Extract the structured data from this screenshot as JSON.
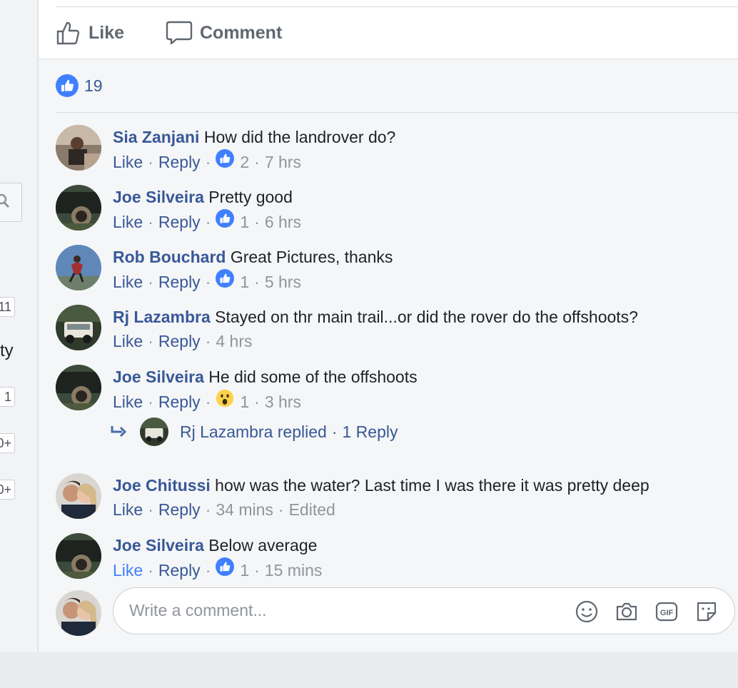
{
  "sidebar": {
    "badges": [
      "11",
      "1",
      "0+",
      "0+"
    ],
    "fragment_text": "ty"
  },
  "actions": {
    "like_label": "Like",
    "comment_label": "Comment"
  },
  "reactions": {
    "count": "19"
  },
  "comments": [
    {
      "author": "Sia Zanjani",
      "text": "How did the landrover do?",
      "like": "Like",
      "reply": "Reply",
      "reaction_count": "2",
      "time": "7 hrs",
      "reaction": "like"
    },
    {
      "author": "Joe Silveira",
      "text": "Pretty good",
      "like": "Like",
      "reply": "Reply",
      "reaction_count": "1",
      "time": "6 hrs",
      "reaction": "like"
    },
    {
      "author": "Rob Bouchard",
      "text": "Great Pictures, thanks",
      "like": "Like",
      "reply": "Reply",
      "reaction_count": "1",
      "time": "5 hrs",
      "reaction": "like"
    },
    {
      "author": "Rj Lazambra",
      "text": "Stayed on thr main trail...or did the rover do the offshoots?",
      "like": "Like",
      "reply": "Reply",
      "time": "4 hrs"
    },
    {
      "author": "Joe Silveira",
      "text": "He did some of the offshoots",
      "like": "Like",
      "reply": "Reply",
      "reaction_count": "1",
      "time": "3 hrs",
      "reaction": "wow"
    },
    {
      "author": "Joe Chitussi",
      "text": "how was the water? Last time I was there it was pretty deep",
      "like": "Like",
      "reply": "Reply",
      "time": "34 mins",
      "edited": "Edited"
    },
    {
      "author": "Joe Silveira",
      "text": "Below average",
      "like": "Like",
      "reply": "Reply",
      "reaction_count": "1",
      "time": "15 mins",
      "reaction": "like"
    }
  ],
  "replies_summary": {
    "text": "Rj Lazambra replied",
    "count": "1 Reply"
  },
  "composer": {
    "placeholder": "Write a comment...",
    "icons": [
      "emoji-icon",
      "camera-icon",
      "gif-icon",
      "sticker-icon"
    ]
  },
  "colors": {
    "link": "#385898",
    "like_blue": "#4080ff",
    "meta_gray": "#90949c"
  }
}
